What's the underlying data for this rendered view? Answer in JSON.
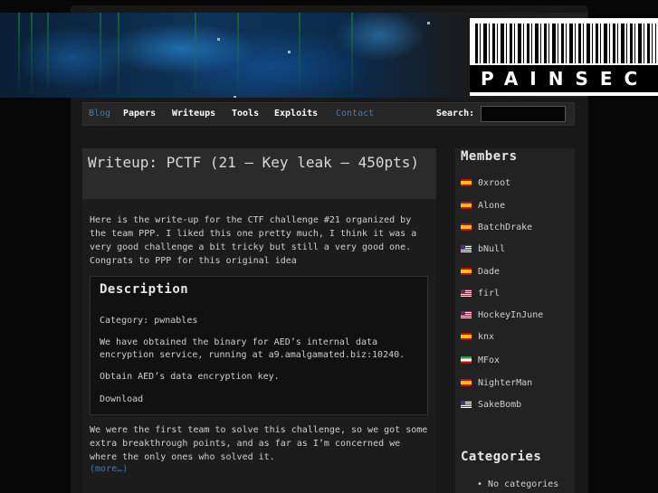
{
  "header": {
    "logo_text": "PAINSEC"
  },
  "nav": {
    "items": [
      {
        "label": "Blog"
      },
      {
        "label": "Papers"
      },
      {
        "label": "Writeups"
      },
      {
        "label": "Tools"
      },
      {
        "label": "Exploits"
      },
      {
        "label": "Contact"
      }
    ],
    "search_label": "Search:",
    "search_value": ""
  },
  "post": {
    "title": "Writeup: PCTF (21 – Key leak – 450pts)",
    "intro": "Here is the write-up for the CTF challenge #21 organized by the team PPP. I liked this one pretty much, I think it was a very good challenge a bit tricky but still a very good one. Congrats to PPP for this original idea",
    "description": {
      "heading": "Description",
      "category": "Category: pwnables",
      "text": "We have obtained the binary for AED’s internal data encryption service, running at a9.amalgamated.biz:10240.",
      "task": "Obtain AED’s data encryption key.",
      "download_label": "Download"
    },
    "outro": "We were the first team to solve this challenge, so we got some extra breakthrough points, and as far as I’m concerned we where the only ones who solved it.",
    "more_label": "(more…)"
  },
  "sidebar": {
    "members_title": "Members",
    "members": [
      {
        "name": "0xroot",
        "flag": "es"
      },
      {
        "name": "Alone",
        "flag": "es"
      },
      {
        "name": "BatchDrake",
        "flag": "es"
      },
      {
        "name": "bNull",
        "flag": "us"
      },
      {
        "name": "Dade",
        "flag": "es"
      },
      {
        "name": "firl",
        "flag": "us"
      },
      {
        "name": "HockeyInJune",
        "flag": "us"
      },
      {
        "name": "knx",
        "flag": "es"
      },
      {
        "name": "MFox",
        "flag": "ir"
      },
      {
        "name": "NighterMan",
        "flag": "es"
      },
      {
        "name": "SakeBomb",
        "flag": "us"
      }
    ],
    "categories_title": "Categories",
    "categories": [
      "No categories"
    ]
  }
}
